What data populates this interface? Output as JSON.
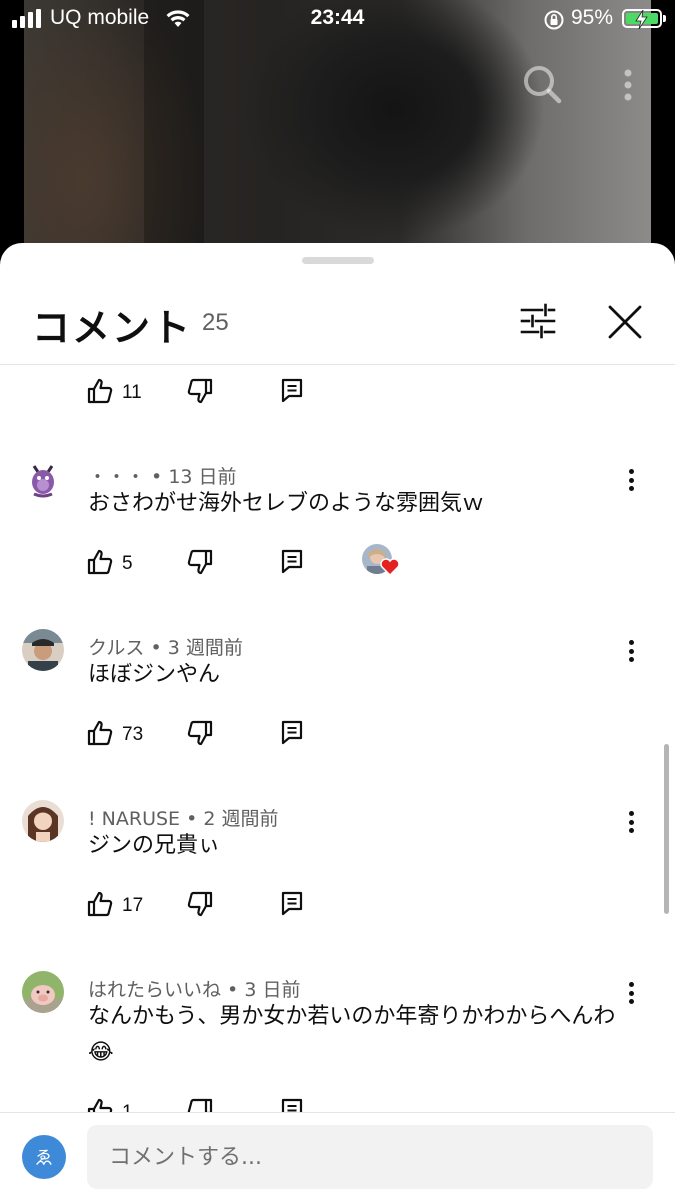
{
  "status_bar": {
    "carrier": "UQ mobile",
    "time": "23:44",
    "battery": "95%"
  },
  "sheet": {
    "title": "コメント",
    "count": "25"
  },
  "partial_comment": {
    "likes": "11"
  },
  "comments": [
    {
      "author": "・・・",
      "time": "13 日前",
      "text": "おさわがせ海外セレブのような雰囲気ｗ",
      "likes": "5",
      "creator_hearted": true
    },
    {
      "author": "クルス",
      "time": "3 週間前",
      "text": "ほぼジンやん",
      "likes": "73"
    },
    {
      "author": "! NARUSE",
      "time": "2 週間前",
      "text": "ジンの兄貴ぃ",
      "likes": "17"
    },
    {
      "author": "はれたらいいね",
      "time": "3 日前",
      "text": "なんかもう、男か女か若いのか年寄りかわからへんわ😂",
      "likes": "1"
    }
  ],
  "composer": {
    "avatar_letter": "ゑ",
    "placeholder": "コメントする..."
  },
  "colors": {
    "accent_blue": "#3e8ad8",
    "heart_red": "#e52222",
    "battery_green": "#4cd964"
  },
  "icons": [
    "search-icon",
    "more-vert-icon",
    "filter-icon",
    "close-icon",
    "thumb-up-icon",
    "thumb-down-icon",
    "reply-icon",
    "heart-icon"
  ]
}
